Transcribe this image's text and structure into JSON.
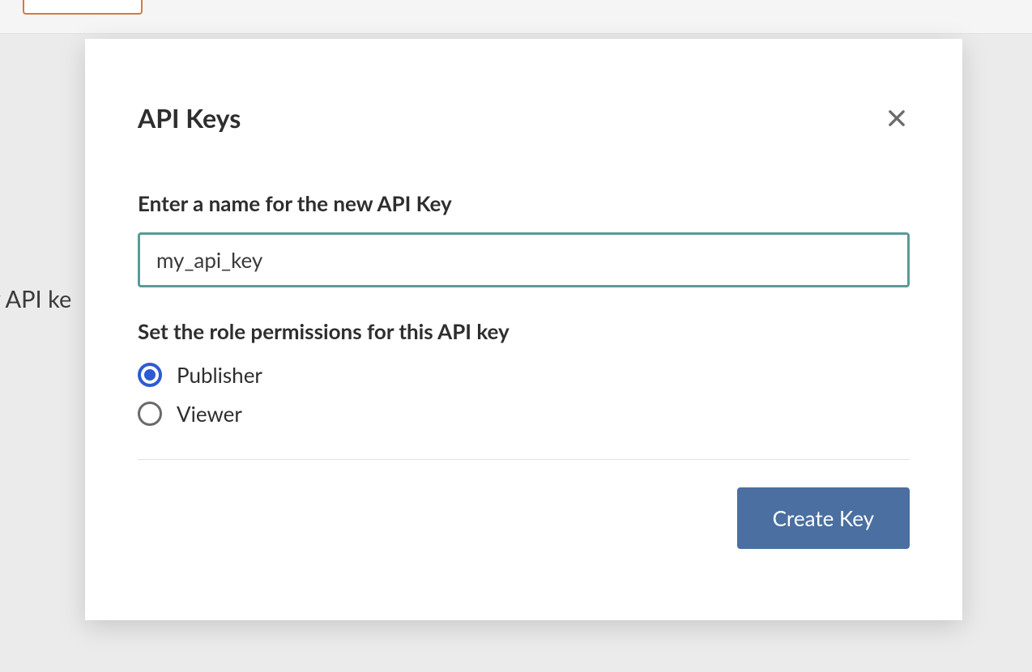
{
  "background": {
    "partial_text": "ny API ke"
  },
  "modal": {
    "title": "API Keys",
    "name_label": "Enter a name for the new API Key",
    "name_value": "my_api_key",
    "role_label": "Set the role permissions for this API key",
    "roles": [
      {
        "label": "Publisher",
        "selected": true
      },
      {
        "label": "Viewer",
        "selected": false
      }
    ],
    "create_button": "Create Key"
  }
}
